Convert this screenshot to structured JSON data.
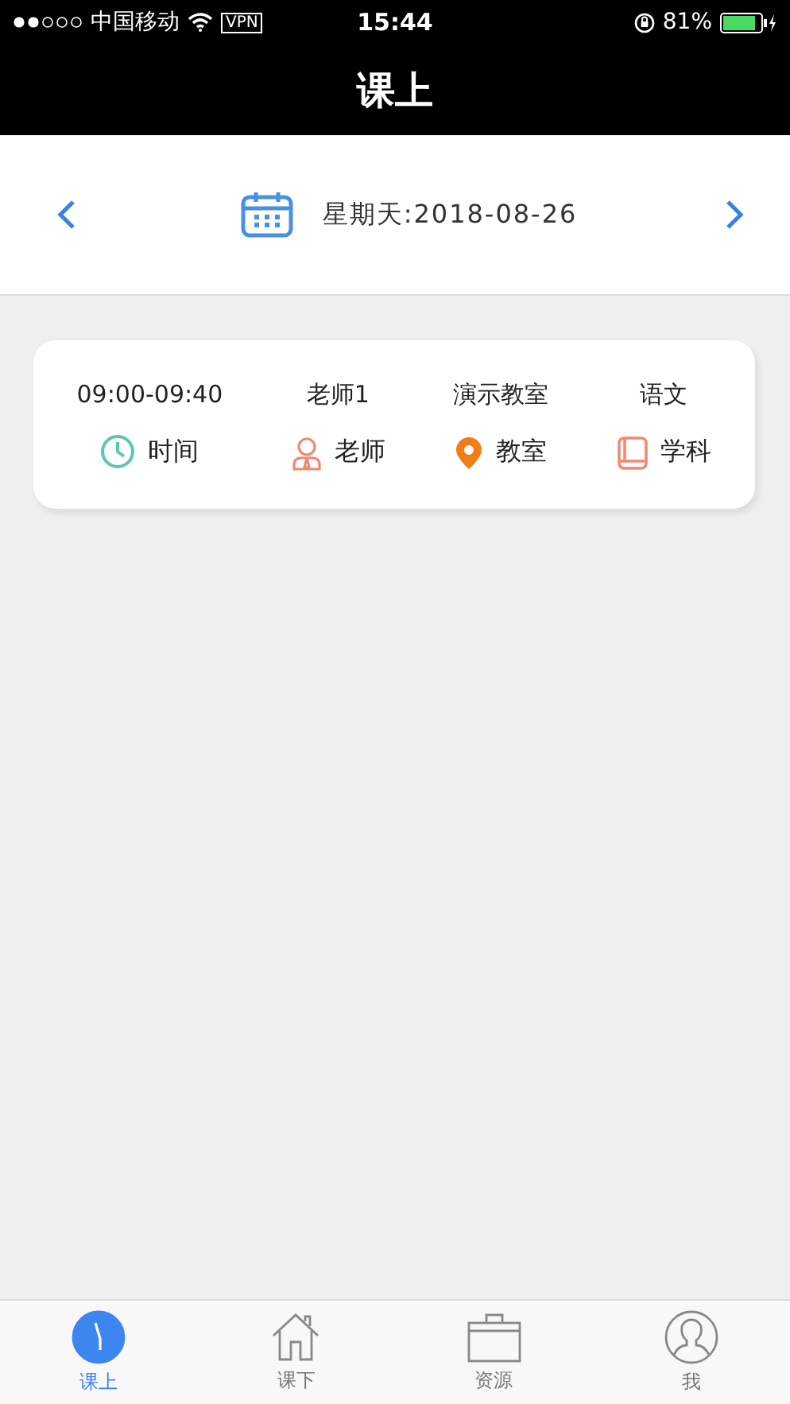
{
  "status_bar": {
    "carrier": "中国移动",
    "vpn": "VPN",
    "time": "15:44",
    "battery": "81%"
  },
  "header": {
    "title": "课上"
  },
  "date_bar": {
    "date": "星期天:2018-08-26"
  },
  "lesson": {
    "items": [
      {
        "value": "09:00-09:40",
        "label": "时间",
        "kind": "clock"
      },
      {
        "value": "老师1",
        "label": "老师",
        "kind": "teacher"
      },
      {
        "value": "演示教室",
        "label": "教室",
        "kind": "pin"
      },
      {
        "value": "语文",
        "label": "学科",
        "kind": "book"
      }
    ]
  },
  "tabs": [
    {
      "label": "课上",
      "selected": true,
      "kind": "clock"
    },
    {
      "label": "课下",
      "selected": false,
      "kind": "home"
    },
    {
      "label": "资源",
      "selected": false,
      "kind": "case"
    },
    {
      "label": "我",
      "selected": false,
      "kind": "user"
    }
  ]
}
